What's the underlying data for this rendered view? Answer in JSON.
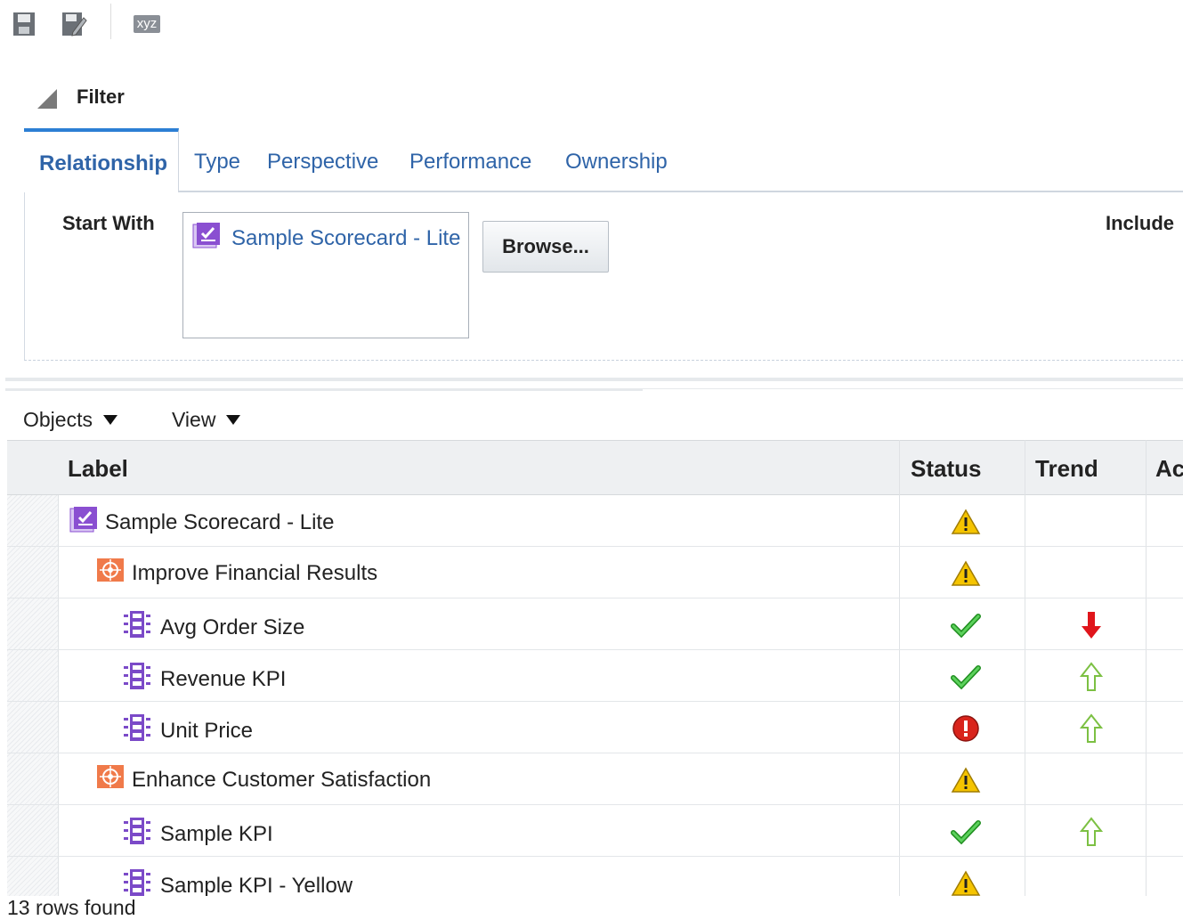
{
  "toolbar": {
    "save_icon": "save-icon",
    "save_as_icon": "save-as-icon",
    "xyz_label": "xyz"
  },
  "filter": {
    "title": "Filter",
    "tabs": [
      {
        "label": "Relationship",
        "active": true
      },
      {
        "label": "Type",
        "active": false
      },
      {
        "label": "Perspective",
        "active": false
      },
      {
        "label": "Performance",
        "active": false
      },
      {
        "label": "Ownership",
        "active": false
      }
    ],
    "start_with_label": "Start With",
    "start_with_value": "Sample Scorecard - Lite",
    "browse_label": "Browse...",
    "include_label": "Include"
  },
  "menus": {
    "objects_label": "Objects",
    "view_label": "View"
  },
  "table": {
    "columns": [
      "Label",
      "Status",
      "Trend",
      "Ac"
    ],
    "rows": [
      {
        "label": "Sample Scorecard - Lite",
        "type": "scorecard",
        "indent": 0,
        "status": "warning",
        "trend": ""
      },
      {
        "label": "Improve Financial Results",
        "type": "objective",
        "indent": 1,
        "status": "warning",
        "trend": ""
      },
      {
        "label": "Avg Order Size",
        "type": "kpi",
        "indent": 2,
        "status": "ok",
        "trend": "down-red"
      },
      {
        "label": "Revenue KPI",
        "type": "kpi",
        "indent": 2,
        "status": "ok",
        "trend": "up-green"
      },
      {
        "label": "Unit Price",
        "type": "kpi",
        "indent": 2,
        "status": "critical",
        "trend": "up-green"
      },
      {
        "label": "Enhance Customer Satisfaction",
        "type": "objective",
        "indent": 1,
        "status": "warning",
        "trend": ""
      },
      {
        "label": "Sample KPI",
        "type": "kpi",
        "indent": 2,
        "status": "ok",
        "trend": "up-green"
      },
      {
        "label": "Sample KPI - Yellow",
        "type": "kpi",
        "indent": 2,
        "status": "warning",
        "trend": ""
      }
    ],
    "footer": "13 rows found"
  },
  "colors": {
    "link": "#2f64a8",
    "active_tab_border": "#2c7fd4",
    "scorecard_icon": "#8a4fd1",
    "objective_icon": "#f07a4a",
    "kpi_icon": "#7b4ac8",
    "status_ok": "#2aa52a",
    "status_warning": "#f2c200",
    "status_critical": "#d9241c",
    "trend_down": "#e0151b",
    "trend_up": "#7cc043"
  }
}
